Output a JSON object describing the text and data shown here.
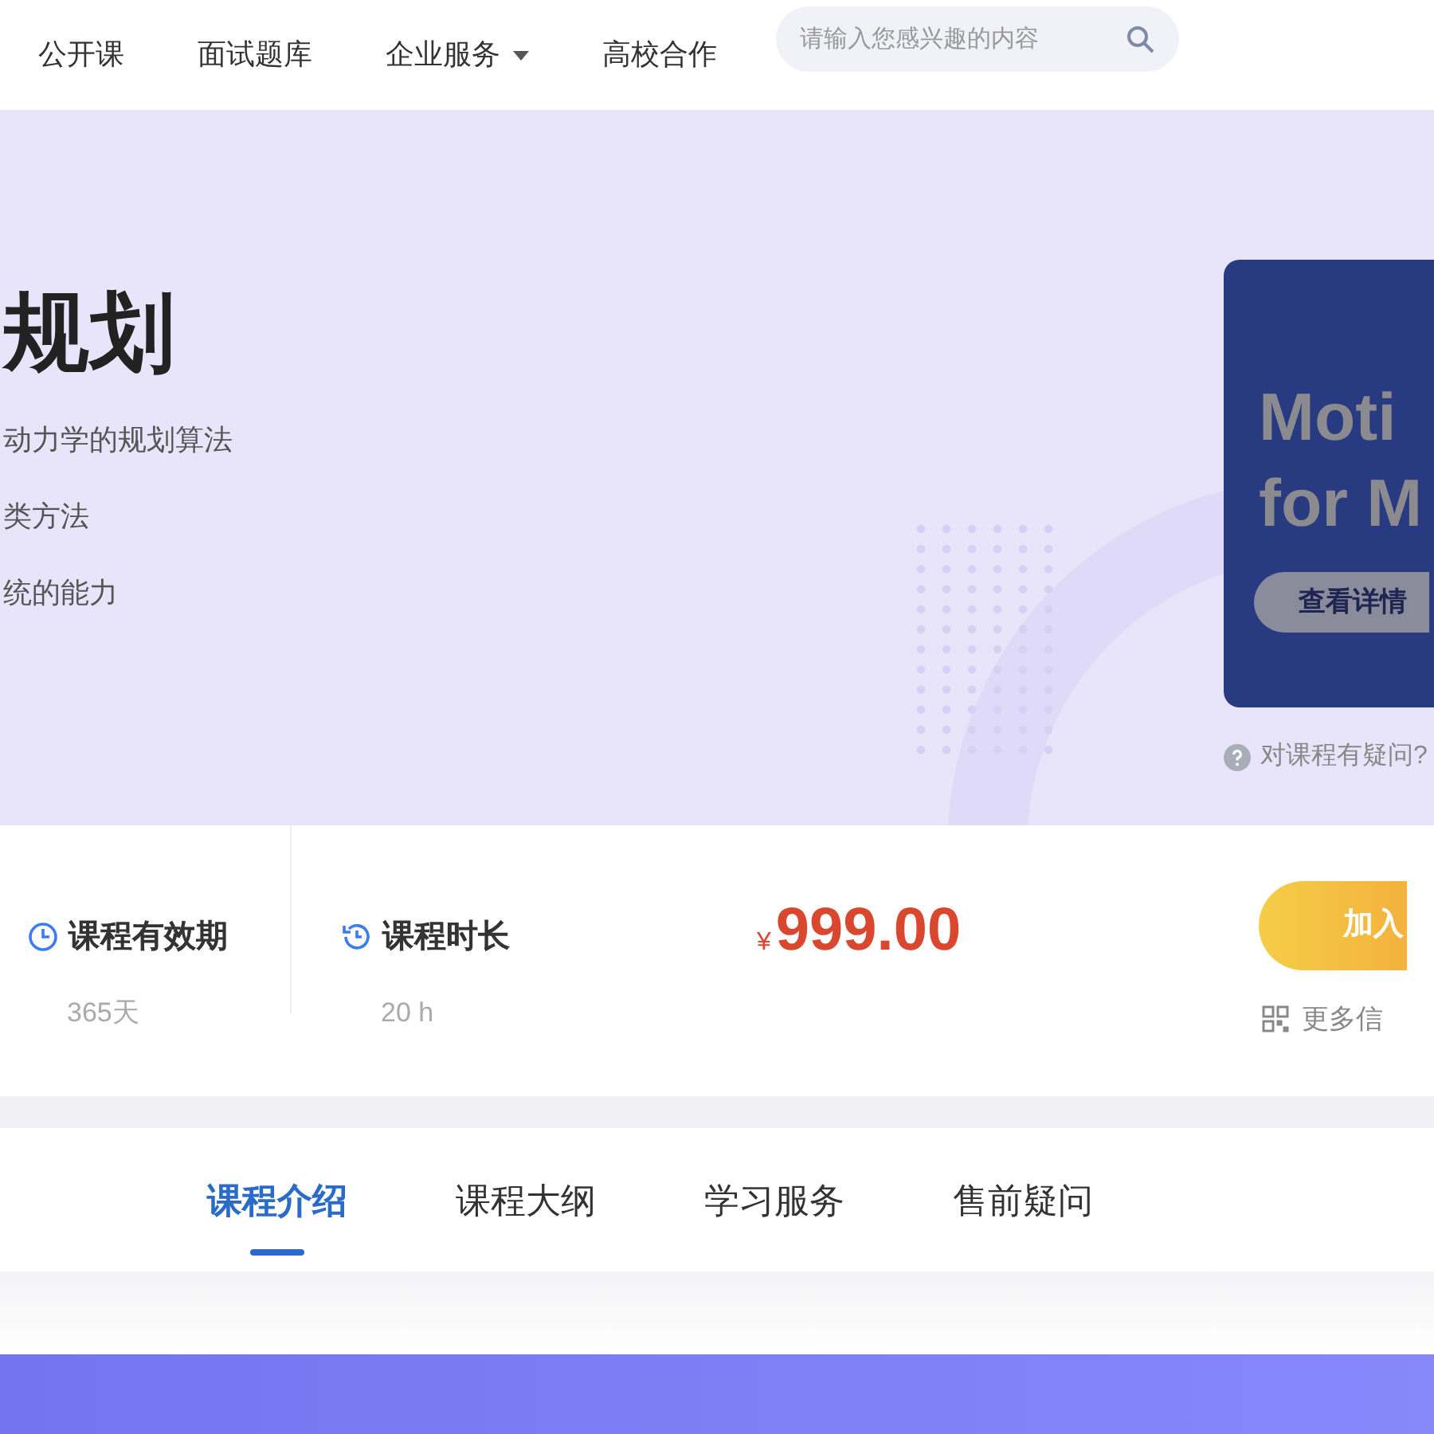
{
  "nav": {
    "items": [
      {
        "label": "公开课",
        "dropdown": false
      },
      {
        "label": "面试题库",
        "dropdown": false
      },
      {
        "label": "企业服务",
        "dropdown": true
      },
      {
        "label": "高校合作",
        "dropdown": false
      }
    ],
    "search": {
      "placeholder": "请输入您感兴趣的内容"
    }
  },
  "hero": {
    "title": "规划",
    "points": [
      "动力学的规划算法",
      "类方法",
      "统的能力"
    ],
    "cover": {
      "lines": [
        "Moti",
        "for M"
      ],
      "button": "查看详情"
    },
    "question": "对课程有疑问?"
  },
  "info": {
    "stats": [
      {
        "label": "课程有效期",
        "value": "365天",
        "kind": "clock"
      },
      {
        "label": "课程时长",
        "value": "20 h",
        "kind": "history"
      }
    ],
    "currency": "¥",
    "price": "999.00",
    "join": "加入",
    "more": "更多信"
  },
  "tabs": [
    {
      "label": "课程介绍",
      "selected": true
    },
    {
      "label": "课程大纲",
      "selected": false
    },
    {
      "label": "学习服务",
      "selected": false
    },
    {
      "label": "售前疑问",
      "selected": false
    }
  ]
}
